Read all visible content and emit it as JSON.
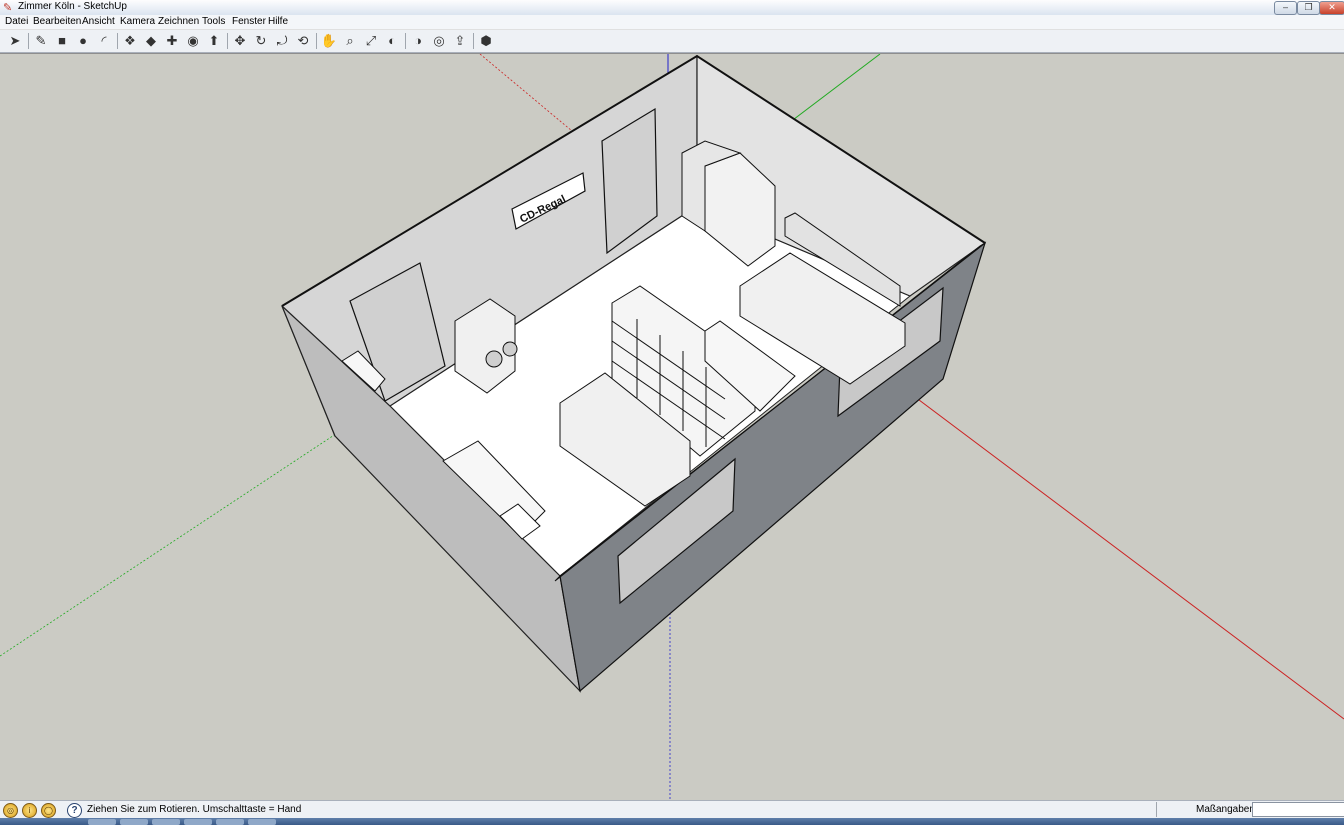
{
  "window": {
    "title": "Zimmer Köln - SketchUp",
    "app_icon": "sketchup-pencil-icon",
    "controls": [
      "minimize",
      "restore",
      "close"
    ]
  },
  "menu": {
    "items": [
      "Datei",
      "Bearbeiten",
      "Ansicht",
      "Kamera",
      "Zeichnen",
      "Tools",
      "Fenster",
      "Hilfe"
    ]
  },
  "toolbar": {
    "tools": [
      {
        "name": "select-icon",
        "glyph": "➤"
      },
      {
        "name": "pencil-icon",
        "glyph": "✎"
      },
      {
        "name": "rectangle-icon",
        "glyph": "■"
      },
      {
        "name": "circle-icon",
        "glyph": "●"
      },
      {
        "name": "arc-icon",
        "glyph": "◜"
      },
      {
        "name": "make-component-icon",
        "glyph": "❖"
      },
      {
        "name": "eraser-icon",
        "glyph": "◆"
      },
      {
        "name": "tape-measure-icon",
        "glyph": "✚"
      },
      {
        "name": "paint-bucket-icon",
        "glyph": "◉"
      },
      {
        "name": "push-pull-icon",
        "glyph": "⬆"
      },
      {
        "name": "move-icon",
        "glyph": "✥"
      },
      {
        "name": "rotate-icon",
        "glyph": "↻"
      },
      {
        "name": "offset-icon",
        "glyph": "⤾"
      },
      {
        "name": "orbit-icon",
        "glyph": "⟲"
      },
      {
        "name": "pan-icon",
        "glyph": "✋"
      },
      {
        "name": "zoom-icon",
        "glyph": "⌕"
      },
      {
        "name": "zoom-extents-icon",
        "glyph": "⤢"
      },
      {
        "name": "previous-view-icon",
        "glyph": "◐"
      },
      {
        "name": "next-view-icon",
        "glyph": "◑"
      },
      {
        "name": "get-models-icon",
        "glyph": "◎"
      },
      {
        "name": "share-model-icon",
        "glyph": "⇪"
      },
      {
        "name": "warehouse-icon",
        "glyph": "⬢"
      }
    ]
  },
  "status": {
    "icons": [
      "geo-location-icon",
      "credits-icon",
      "user-icon"
    ],
    "help": "?",
    "text": "Ziehen Sie zum Rotieren.  Umschalttaste = Hand",
    "measure_label": "Maßangaben",
    "measure_value": ""
  },
  "scene": {
    "sign_text": "CD-Regal",
    "colors": {
      "background": "#cbcbc4",
      "floor": "#ffffff",
      "wall_inner": "#d9d9d9",
      "wall_front": "#7f8388",
      "axis_red": "#cc2222",
      "axis_green": "#22aa22",
      "axis_blue": "#2222cc"
    }
  }
}
